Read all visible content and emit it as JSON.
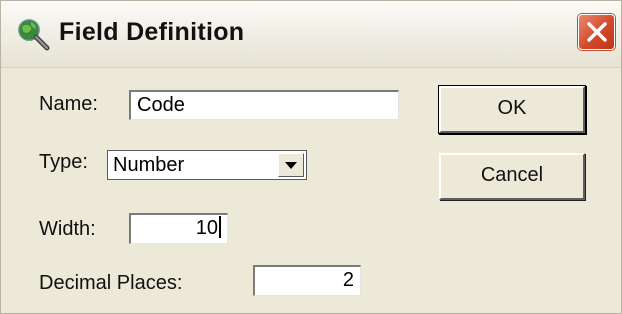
{
  "window": {
    "title": "Field Definition",
    "icon": "magnifier-globe-icon",
    "close_icon": "close-icon"
  },
  "form": {
    "name": {
      "label": "Name:",
      "value": "Code"
    },
    "type": {
      "label": "Type:",
      "selected": "Number"
    },
    "width": {
      "label": "Width:",
      "value": "10"
    },
    "decimal_places": {
      "label": "Decimal Places:",
      "value": "2"
    }
  },
  "buttons": {
    "ok_label": "OK",
    "cancel_label": "Cancel"
  },
  "colors": {
    "dialog_bg": "#ece9d8",
    "close_button": "#d2492b"
  }
}
